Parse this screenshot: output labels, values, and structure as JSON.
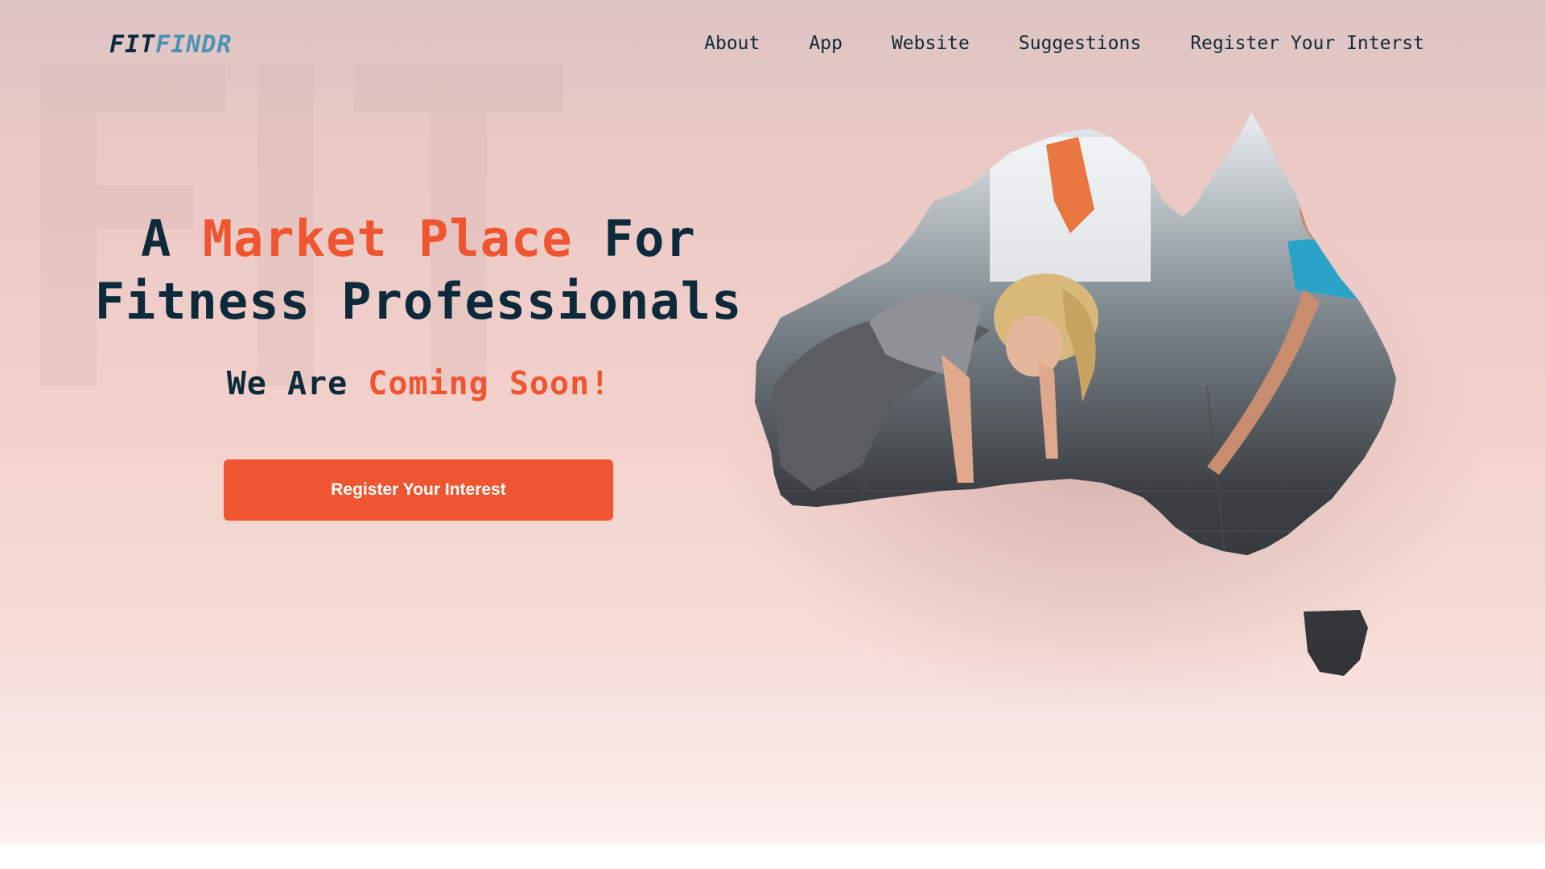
{
  "header": {
    "logo": {
      "part1": "FIT",
      "part2": "FINDR"
    },
    "nav": [
      {
        "label": "About"
      },
      {
        "label": "App"
      },
      {
        "label": "Website"
      },
      {
        "label": "Suggestions"
      },
      {
        "label": "Register Your Interst"
      }
    ]
  },
  "hero": {
    "title_line1_a": "A ",
    "title_line1_accent": "Market Place",
    "title_line1_b": " For",
    "title_line2": "Fitness Professionals",
    "subtitle_a": "We Are ",
    "subtitle_accent": "Coming Soon!",
    "cta_label": "Register Your Interest"
  },
  "colors": {
    "accent": "#ef5530",
    "dark": "#0d2a3b",
    "logo_blue": "#4e93b3"
  },
  "icons": {
    "hero_image": "australia-map-fitness-photo"
  }
}
